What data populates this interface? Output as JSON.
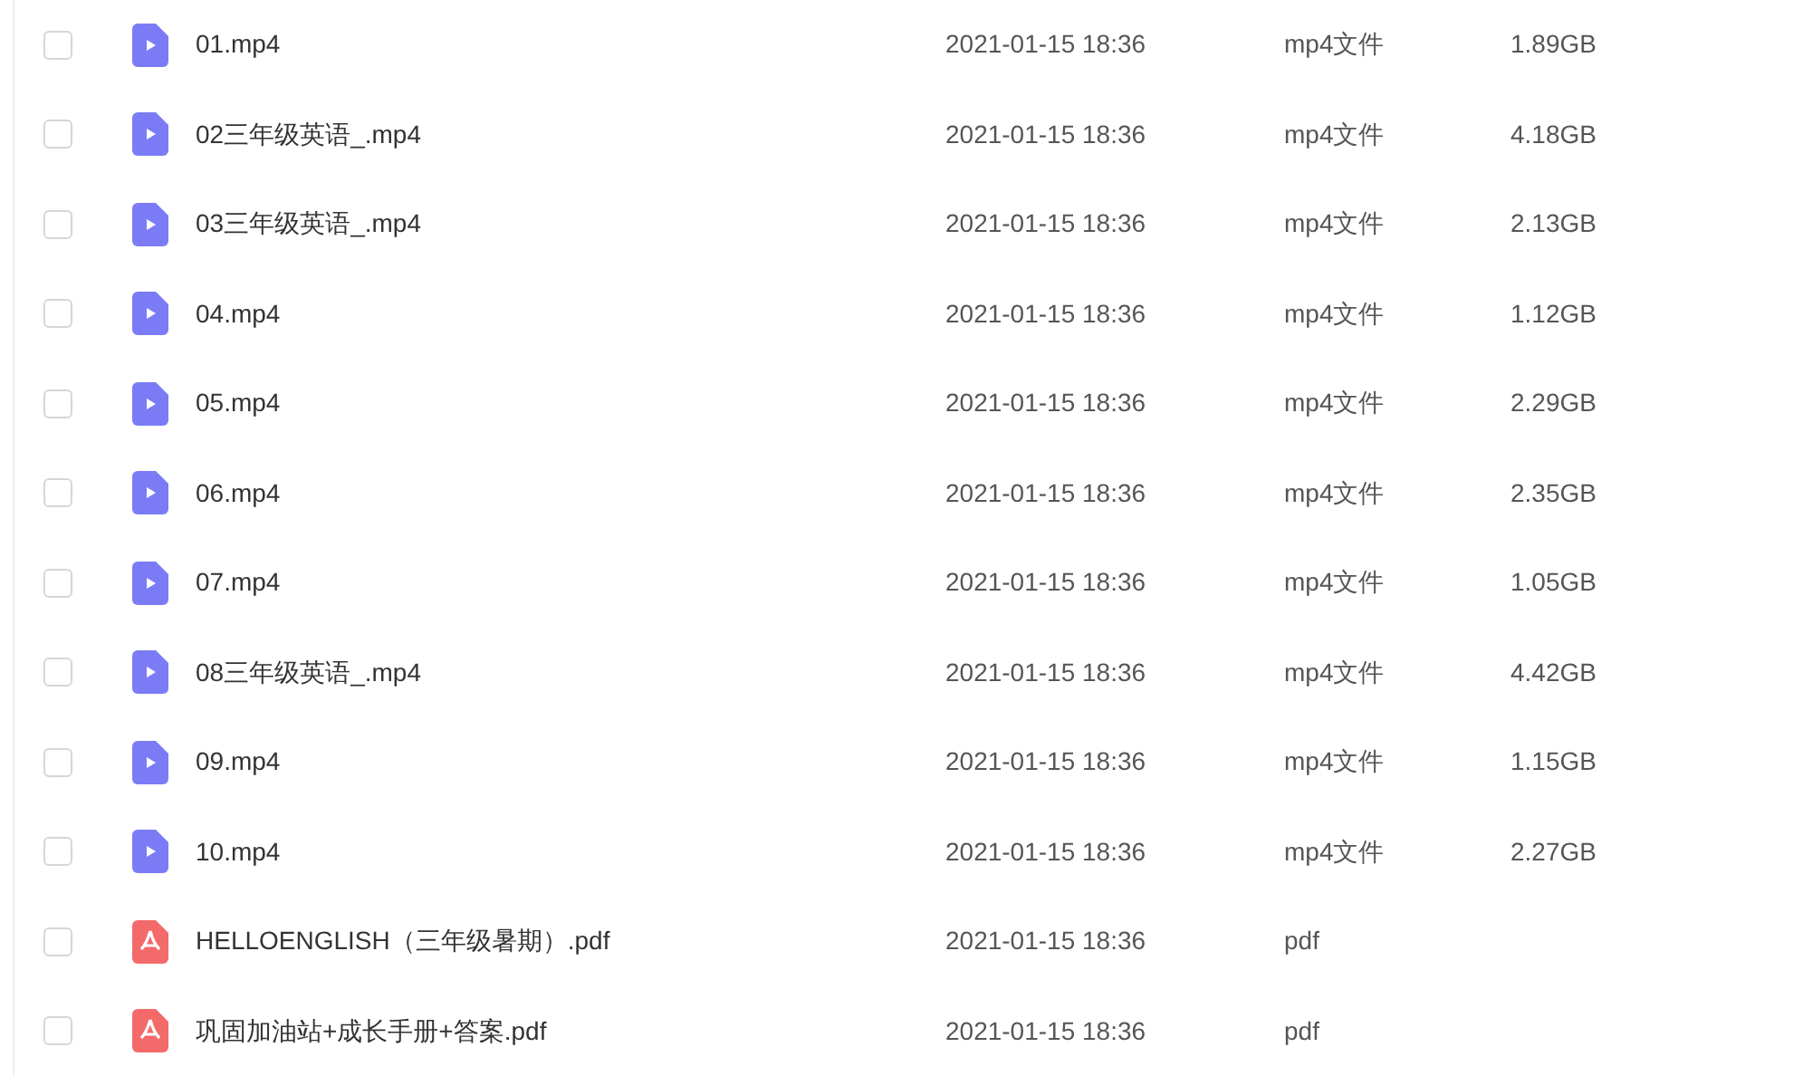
{
  "files": [
    {
      "kind": "video",
      "checked": false,
      "name": "01.mp4",
      "modified": "2021-01-15 18:36",
      "type": "mp4文件",
      "size": "1.89GB"
    },
    {
      "kind": "video",
      "checked": false,
      "name": "02三年级英语_.mp4",
      "modified": "2021-01-15 18:36",
      "type": "mp4文件",
      "size": "4.18GB"
    },
    {
      "kind": "video",
      "checked": false,
      "name": "03三年级英语_.mp4",
      "modified": "2021-01-15 18:36",
      "type": "mp4文件",
      "size": "2.13GB"
    },
    {
      "kind": "video",
      "checked": false,
      "name": "04.mp4",
      "modified": "2021-01-15 18:36",
      "type": "mp4文件",
      "size": "1.12GB"
    },
    {
      "kind": "video",
      "checked": false,
      "name": "05.mp4",
      "modified": "2021-01-15 18:36",
      "type": "mp4文件",
      "size": "2.29GB"
    },
    {
      "kind": "video",
      "checked": false,
      "name": "06.mp4",
      "modified": "2021-01-15 18:36",
      "type": "mp4文件",
      "size": "2.35GB"
    },
    {
      "kind": "video",
      "checked": false,
      "name": "07.mp4",
      "modified": "2021-01-15 18:36",
      "type": "mp4文件",
      "size": "1.05GB"
    },
    {
      "kind": "video",
      "checked": false,
      "name": "08三年级英语_.mp4",
      "modified": "2021-01-15 18:36",
      "type": "mp4文件",
      "size": "4.42GB"
    },
    {
      "kind": "video",
      "checked": false,
      "name": "09.mp4",
      "modified": "2021-01-15 18:36",
      "type": "mp4文件",
      "size": "1.15GB"
    },
    {
      "kind": "video",
      "checked": false,
      "name": "10.mp4",
      "modified": "2021-01-15 18:36",
      "type": "mp4文件",
      "size": "2.27GB"
    },
    {
      "kind": "pdf",
      "checked": false,
      "name": "HELLOENGLISH（三年级暑期）.pdf",
      "modified": "2021-01-15 18:36",
      "type": "pdf"
    },
    {
      "kind": "pdf",
      "checked": false,
      "name": "巩固加油站+成长手册+答案.pdf",
      "modified": "2021-01-15 18:36",
      "type": "pdf"
    }
  ]
}
